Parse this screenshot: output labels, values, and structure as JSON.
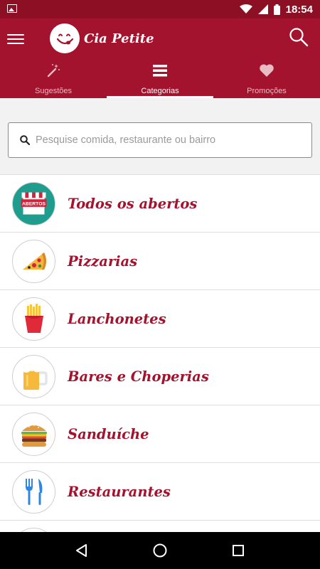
{
  "status_bar": {
    "time": "18:54"
  },
  "app": {
    "name": "Cia Petite",
    "brand_color": "#a3132d"
  },
  "tabs": [
    {
      "label": "Sugestões",
      "icon": "magic-wand-icon",
      "active": false
    },
    {
      "label": "Categorias",
      "icon": "list-icon",
      "active": true
    },
    {
      "label": "Promoções",
      "icon": "heart-icon",
      "active": false
    }
  ],
  "search": {
    "placeholder": "Pesquise comida, restaurante ou bairro",
    "value": ""
  },
  "categories": [
    {
      "label": "Todos os abertos",
      "icon": "open-store-icon",
      "badge": "ABERTOS"
    },
    {
      "label": "Pizzarias",
      "icon": "pizza-icon"
    },
    {
      "label": "Lanchonetes",
      "icon": "fries-icon"
    },
    {
      "label": "Bares e Choperias",
      "icon": "beer-mug-icon"
    },
    {
      "label": "Sanduíche",
      "icon": "burger-icon"
    },
    {
      "label": "Restaurantes",
      "icon": "fork-knife-icon"
    }
  ]
}
